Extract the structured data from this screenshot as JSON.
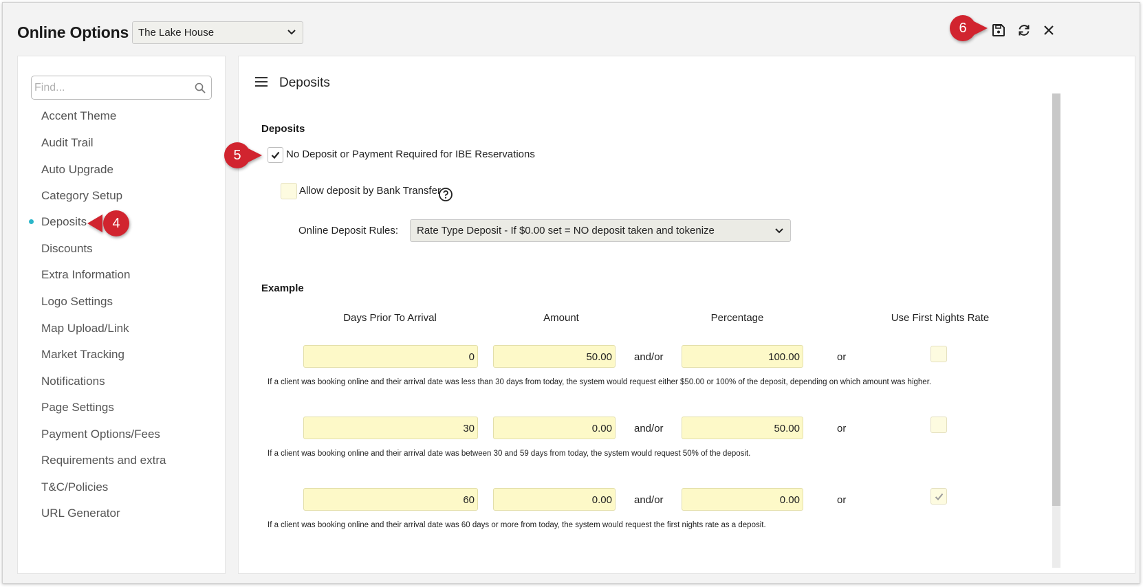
{
  "header": {
    "title": "Online Options",
    "property_selected": "The Lake House"
  },
  "toolbar": {
    "save_icon": "save-icon",
    "refresh_icon": "refresh-icon",
    "close_icon": "close-icon"
  },
  "callouts": {
    "save": "6",
    "checkbox": "5",
    "nav": "4"
  },
  "sidebar": {
    "search_placeholder": "Find...",
    "items": [
      {
        "label": "Accent Theme"
      },
      {
        "label": "Audit Trail"
      },
      {
        "label": "Auto Upgrade"
      },
      {
        "label": "Category Setup"
      },
      {
        "label": "Deposits",
        "active": true
      },
      {
        "label": "Discounts"
      },
      {
        "label": "Extra Information"
      },
      {
        "label": "Logo Settings"
      },
      {
        "label": "Map Upload/Link"
      },
      {
        "label": "Market Tracking"
      },
      {
        "label": "Notifications"
      },
      {
        "label": "Page Settings"
      },
      {
        "label": "Payment Options/Fees"
      },
      {
        "label": "Requirements and extra"
      },
      {
        "label": "T&C/Policies"
      },
      {
        "label": "URL Generator"
      }
    ]
  },
  "main": {
    "page_title": "Deposits",
    "deposits_section": {
      "heading": "Deposits",
      "no_deposit_label": "No Deposit or Payment Required for IBE Reservations",
      "no_deposit_checked": true,
      "bank_transfer_label": "Allow deposit by Bank Transfer",
      "bank_transfer_checked": false,
      "rules_label": "Online Deposit Rules:",
      "rules_selected": "Rate Type Deposit - If $0.00 set = NO deposit taken and tokenize"
    },
    "example_section": {
      "heading": "Example",
      "columns": [
        "Days Prior To Arrival",
        "Amount",
        "Percentage",
        "Use First Nights Rate"
      ],
      "andor_text": "and/or",
      "or_text": "or",
      "rows": [
        {
          "days": "0",
          "amount": "50.00",
          "percentage": "100.00",
          "first_nights": false,
          "note": "If a client was booking online and their arrival date was less than 30 days from today, the system would request either $50.00 or 100% of the deposit, depending on which amount was higher."
        },
        {
          "days": "30",
          "amount": "0.00",
          "percentage": "50.00",
          "first_nights": false,
          "note": "If a client was booking online and their arrival date was between 30 and 59 days from today, the system would request 50% of the deposit."
        },
        {
          "days": "60",
          "amount": "0.00",
          "percentage": "0.00",
          "first_nights": true,
          "note": "If a client was booking online and their arrival date was 60 days or more from today, the system would request the first nights rate as a deposit."
        }
      ]
    }
  },
  "colors": {
    "callout_red": "#d1242f",
    "accent_dot": "#2bb6c9",
    "input_yellow": "#fdf9c8"
  }
}
